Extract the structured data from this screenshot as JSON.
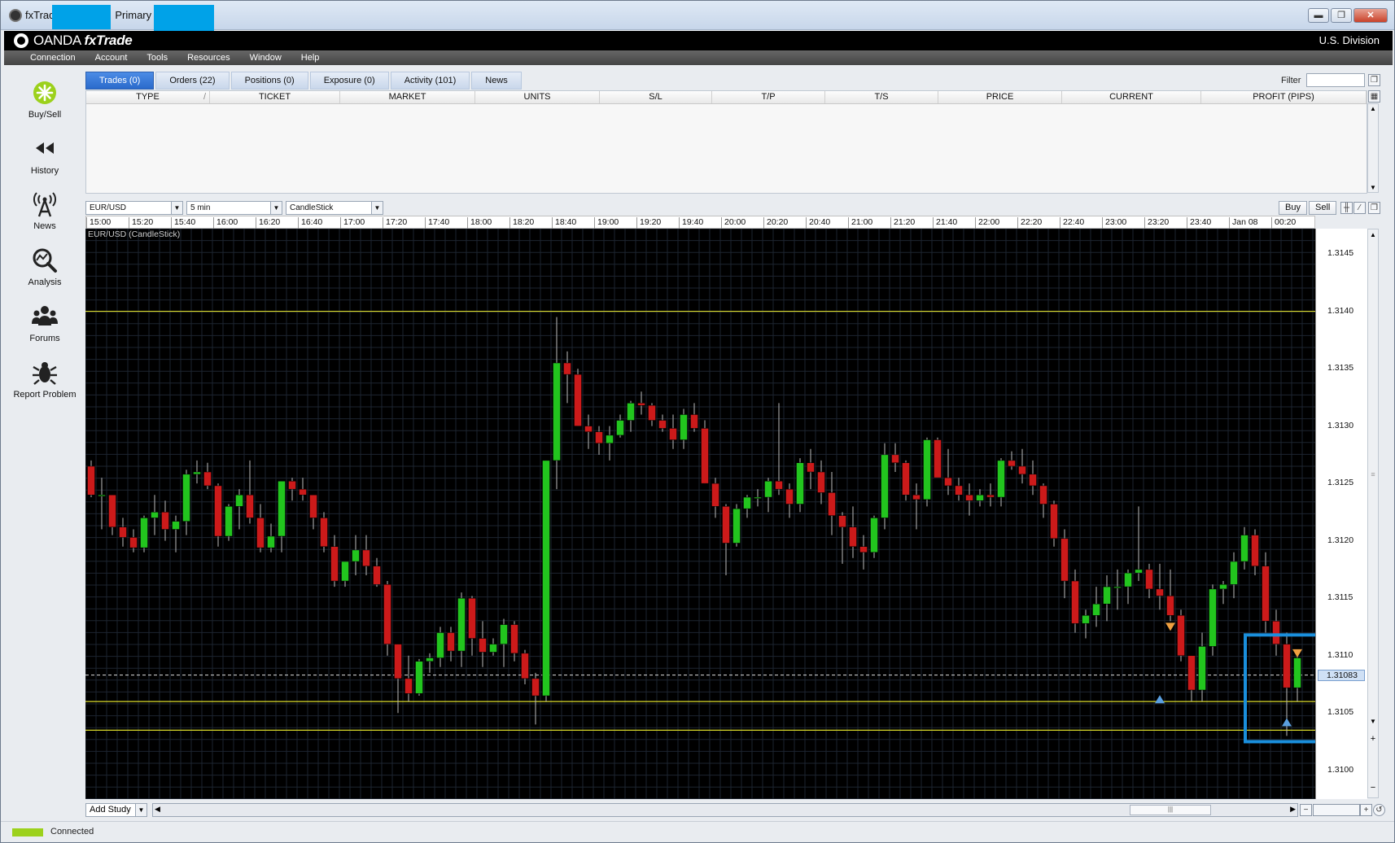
{
  "window": {
    "title_prefix": "fxTrad",
    "title_suffix": "Primary (&",
    "minimize": "▬",
    "maximize": "❐",
    "close": "✕"
  },
  "brand": {
    "logo_plain": "OANDA ",
    "logo_bold": "fxTrade",
    "division": "U.S. Division"
  },
  "menu": [
    "Connection",
    "Account",
    "Tools",
    "Resources",
    "Window",
    "Help"
  ],
  "sidebar": [
    {
      "label": "Buy/Sell",
      "icon": "buy-sell-icon"
    },
    {
      "label": "History",
      "icon": "history-icon"
    },
    {
      "label": "News",
      "icon": "news-antenna-icon"
    },
    {
      "label": "Analysis",
      "icon": "analysis-icon"
    },
    {
      "label": "Forums",
      "icon": "forums-icon"
    },
    {
      "label": "Report Problem",
      "icon": "report-bug-icon"
    }
  ],
  "trade_panel": {
    "tabs": [
      "Trades (0)",
      "Orders (22)",
      "Positions (0)",
      "Exposure (0)",
      "Activity (101)",
      "News"
    ],
    "active_tab": "Trades (0)",
    "filter_label": "Filter",
    "filter_value": "",
    "columns": [
      "TYPE",
      "TICKET",
      "MARKET",
      "UNITS",
      "S/L",
      "T/P",
      "T/S",
      "PRICE",
      "CURRENT",
      "PROFIT (PIPS)"
    ],
    "sort_indicator": "/"
  },
  "chart_toolbar": {
    "instrument": "EUR/USD",
    "granularity": "5 min",
    "chart_style": "CandleStick",
    "buy_label": "Buy",
    "sell_label": "Sell"
  },
  "chart_data": {
    "type": "candlestick",
    "title": "EUR/USD (CandleStick)",
    "time_ticks": [
      "15:00",
      "15:20",
      "15:40",
      "16:00",
      "16:20",
      "16:40",
      "17:00",
      "17:20",
      "17:40",
      "18:00",
      "18:20",
      "18:40",
      "19:00",
      "19:20",
      "19:40",
      "20:00",
      "20:20",
      "20:40",
      "21:00",
      "21:20",
      "21:40",
      "22:00",
      "22:20",
      "22:40",
      "23:00",
      "23:20",
      "23:40",
      "Jan 08",
      "00:20"
    ],
    "price_ticks": [
      "1.3145",
      "1.3140",
      "1.3135",
      "1.3130",
      "1.3125",
      "1.3120",
      "1.3115",
      "1.3110",
      "1.3105",
      "1.3100"
    ],
    "ylim": [
      1.30975,
      1.31472
    ],
    "current_price": "1.31083",
    "candle_interval_minutes": 5,
    "horizontal_lines": [
      1.314,
      1.3106,
      1.31035
    ],
    "colors": {
      "up": "#22c51e",
      "down": "#cc1a1a",
      "grid": "#1d2530",
      "level_line": "#d9d92a",
      "highlight": "#1a8fdc"
    },
    "candles": [
      [
        1.31265,
        1.3127,
        1.31238,
        1.3124
      ],
      [
        1.3124,
        1.31255,
        1.3121,
        1.3124
      ],
      [
        1.3124,
        1.3124,
        1.31205,
        1.31212
      ],
      [
        1.31212,
        1.3122,
        1.31195,
        1.31203
      ],
      [
        1.31203,
        1.3121,
        1.3119,
        1.31194
      ],
      [
        1.31194,
        1.31222,
        1.3119,
        1.3122
      ],
      [
        1.3122,
        1.3124,
        1.31205,
        1.31225
      ],
      [
        1.31225,
        1.31235,
        1.312,
        1.3121
      ],
      [
        1.3121,
        1.31222,
        1.3119,
        1.31217
      ],
      [
        1.31217,
        1.31262,
        1.31205,
        1.31258
      ],
      [
        1.31258,
        1.3127,
        1.3125,
        1.3126
      ],
      [
        1.3126,
        1.31268,
        1.31245,
        1.31248
      ],
      [
        1.31248,
        1.3125,
        1.31195,
        1.31204
      ],
      [
        1.31204,
        1.31232,
        1.312,
        1.3123
      ],
      [
        1.3123,
        1.31245,
        1.3121,
        1.3124
      ],
      [
        1.3124,
        1.3127,
        1.31215,
        1.3122
      ],
      [
        1.3122,
        1.31232,
        1.3119,
        1.31194
      ],
      [
        1.31194,
        1.31215,
        1.3119,
        1.31204
      ],
      [
        1.31204,
        1.31252,
        1.3119,
        1.31252
      ],
      [
        1.31252,
        1.31255,
        1.31235,
        1.31245
      ],
      [
        1.31245,
        1.31255,
        1.31235,
        1.3124
      ],
      [
        1.3124,
        1.3124,
        1.3121,
        1.3122
      ],
      [
        1.3122,
        1.31225,
        1.3119,
        1.31195
      ],
      [
        1.31195,
        1.31205,
        1.3116,
        1.31165
      ],
      [
        1.31165,
        1.3118,
        1.3116,
        1.31182
      ],
      [
        1.31182,
        1.31205,
        1.3117,
        1.31192
      ],
      [
        1.31192,
        1.31205,
        1.3117,
        1.31178
      ],
      [
        1.31178,
        1.31185,
        1.3116,
        1.31162
      ],
      [
        1.31162,
        1.31165,
        1.311,
        1.3111
      ],
      [
        1.3111,
        1.3111,
        1.3105,
        1.3108
      ],
      [
        1.3108,
        1.311,
        1.3106,
        1.31067
      ],
      [
        1.31067,
        1.31097,
        1.31065,
        1.31095
      ],
      [
        1.31095,
        1.31102,
        1.31085,
        1.31098
      ],
      [
        1.31098,
        1.31125,
        1.3109,
        1.3112
      ],
      [
        1.3112,
        1.31125,
        1.31095,
        1.31104
      ],
      [
        1.31104,
        1.31155,
        1.3109,
        1.3115
      ],
      [
        1.3115,
        1.31152,
        1.311,
        1.31115
      ],
      [
        1.31115,
        1.3113,
        1.3109,
        1.31103
      ],
      [
        1.31103,
        1.31115,
        1.311,
        1.3111
      ],
      [
        1.3111,
        1.31132,
        1.3109,
        1.31127
      ],
      [
        1.31127,
        1.3113,
        1.31095,
        1.31102
      ],
      [
        1.31102,
        1.31105,
        1.31075,
        1.3108
      ],
      [
        1.3108,
        1.31085,
        1.3104,
        1.31065
      ],
      [
        1.31065,
        1.3127,
        1.3106,
        1.3127
      ],
      [
        1.3127,
        1.31395,
        1.31245,
        1.31355
      ],
      [
        1.31355,
        1.31365,
        1.3132,
        1.31345
      ],
      [
        1.31345,
        1.3135,
        1.313,
        1.313
      ],
      [
        1.313,
        1.3131,
        1.3128,
        1.31295
      ],
      [
        1.31295,
        1.313,
        1.31275,
        1.31285
      ],
      [
        1.31285,
        1.313,
        1.3127,
        1.31292
      ],
      [
        1.31292,
        1.3131,
        1.3129,
        1.31305
      ],
      [
        1.31305,
        1.31322,
        1.31295,
        1.3132
      ],
      [
        1.3132,
        1.3133,
        1.3131,
        1.31318
      ],
      [
        1.31318,
        1.3132,
        1.313,
        1.31305
      ],
      [
        1.31305,
        1.3131,
        1.31295,
        1.31298
      ],
      [
        1.31298,
        1.3131,
        1.3128,
        1.31288
      ],
      [
        1.31288,
        1.31315,
        1.3128,
        1.3131
      ],
      [
        1.3131,
        1.3132,
        1.31295,
        1.31298
      ],
      [
        1.31298,
        1.31305,
        1.3125,
        1.3125
      ],
      [
        1.3125,
        1.31255,
        1.3122,
        1.3123
      ],
      [
        1.3123,
        1.31232,
        1.3117,
        1.31198
      ],
      [
        1.31198,
        1.31232,
        1.31195,
        1.31228
      ],
      [
        1.31228,
        1.3124,
        1.3122,
        1.31238
      ],
      [
        1.31238,
        1.31245,
        1.3123,
        1.31238
      ],
      [
        1.31238,
        1.31255,
        1.31225,
        1.31252
      ],
      [
        1.31252,
        1.3132,
        1.3124,
        1.31245
      ],
      [
        1.31245,
        1.3125,
        1.3122,
        1.31232
      ],
      [
        1.31232,
        1.31272,
        1.31225,
        1.31268
      ],
      [
        1.31268,
        1.3128,
        1.31245,
        1.3126
      ],
      [
        1.3126,
        1.3127,
        1.31232,
        1.31242
      ],
      [
        1.31242,
        1.3126,
        1.31205,
        1.31222
      ],
      [
        1.31222,
        1.31225,
        1.3118,
        1.31212
      ],
      [
        1.31212,
        1.3123,
        1.31185,
        1.31195
      ],
      [
        1.31195,
        1.31205,
        1.31175,
        1.3119
      ],
      [
        1.3119,
        1.31222,
        1.31185,
        1.3122
      ],
      [
        1.3122,
        1.31285,
        1.3121,
        1.31275
      ],
      [
        1.31275,
        1.31285,
        1.3126,
        1.31268
      ],
      [
        1.31268,
        1.3127,
        1.31235,
        1.3124
      ],
      [
        1.3124,
        1.3125,
        1.3121,
        1.31236
      ],
      [
        1.31236,
        1.3129,
        1.3123,
        1.31288
      ],
      [
        1.31288,
        1.3129,
        1.3126,
        1.31255
      ],
      [
        1.31255,
        1.3128,
        1.3124,
        1.31248
      ],
      [
        1.31248,
        1.31255,
        1.31235,
        1.3124
      ],
      [
        1.3124,
        1.3125,
        1.31222,
        1.31235
      ],
      [
        1.31235,
        1.31245,
        1.3123,
        1.3124
      ],
      [
        1.3124,
        1.3125,
        1.3123,
        1.31238
      ],
      [
        1.31238,
        1.31272,
        1.3123,
        1.3127
      ],
      [
        1.3127,
        1.31278,
        1.31262,
        1.31265
      ],
      [
        1.31265,
        1.3128,
        1.3125,
        1.31258
      ],
      [
        1.31258,
        1.3127,
        1.3124,
        1.31248
      ],
      [
        1.31248,
        1.3125,
        1.3122,
        1.31232
      ],
      [
        1.31232,
        1.31235,
        1.31195,
        1.31202
      ],
      [
        1.31202,
        1.3121,
        1.3115,
        1.31165
      ],
      [
        1.31165,
        1.31175,
        1.3112,
        1.31128
      ],
      [
        1.31128,
        1.3114,
        1.31115,
        1.31135
      ],
      [
        1.31135,
        1.3116,
        1.31125,
        1.31145
      ],
      [
        1.31145,
        1.3117,
        1.3113,
        1.3116
      ],
      [
        1.3116,
        1.31175,
        1.3114,
        1.3116
      ],
      [
        1.3116,
        1.31175,
        1.31145,
        1.31172
      ],
      [
        1.31172,
        1.3123,
        1.31165,
        1.31175
      ],
      [
        1.31175,
        1.3118,
        1.3115,
        1.31158
      ],
      [
        1.31158,
        1.3118,
        1.3114,
        1.31152
      ],
      [
        1.31152,
        1.31175,
        1.3113,
        1.31135
      ],
      [
        1.31135,
        1.3114,
        1.31095,
        1.311
      ],
      [
        1.311,
        1.311,
        1.3106,
        1.3107
      ],
      [
        1.3107,
        1.3112,
        1.3106,
        1.31108
      ],
      [
        1.31108,
        1.31162,
        1.311,
        1.31158
      ],
      [
        1.31158,
        1.31165,
        1.31145,
        1.31162
      ],
      [
        1.31162,
        1.3119,
        1.3115,
        1.31182
      ],
      [
        1.31182,
        1.31212,
        1.31175,
        1.31205
      ],
      [
        1.31205,
        1.3121,
        1.3117,
        1.31178
      ],
      [
        1.31178,
        1.3119,
        1.3112,
        1.3113
      ],
      [
        1.3113,
        1.3114,
        1.311,
        1.3111
      ],
      [
        1.3111,
        1.3112,
        1.3103,
        1.31072
      ],
      [
        1.31072,
        1.311,
        1.3106,
        1.31098
      ]
    ],
    "markers": [
      {
        "type": "sell-order",
        "x_index": 102,
        "price": 1.31125
      },
      {
        "type": "buy-order",
        "x_index": 101,
        "price": 1.31062
      },
      {
        "type": "sell-order",
        "x_index": 114,
        "price": 1.31102
      },
      {
        "type": "buy-order",
        "x_index": 113,
        "price": 1.31042
      }
    ]
  },
  "bottom_bar": {
    "add_study": "Add Study",
    "thumb_grip": "|||",
    "zoom_out": "−",
    "zoom_in": "+"
  },
  "status": {
    "text": "Connected",
    "color": "#9cd11c"
  }
}
